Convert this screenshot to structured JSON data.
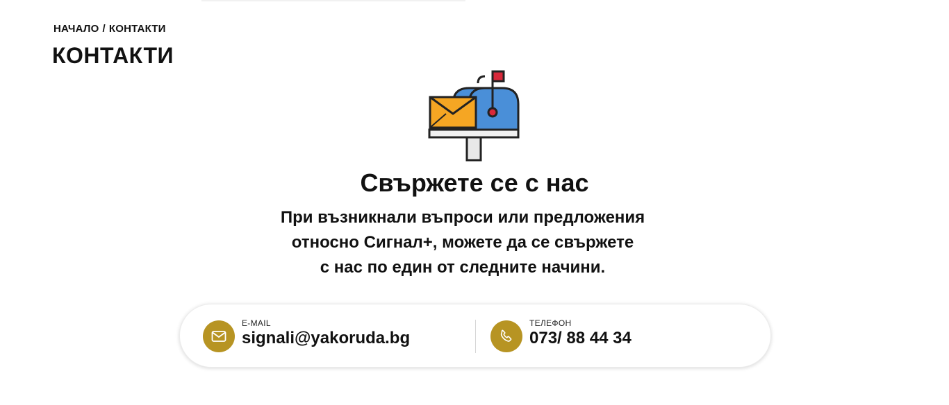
{
  "breadcrumb": {
    "home": "НАЧАЛО",
    "separator": "/",
    "current": "КОНТАКТИ"
  },
  "page_title": "КОНТАКТИ",
  "hero": {
    "icon": "mailbox-icon",
    "heading": "Свържете се с нас",
    "intro_lines": [
      "При възникнали въпроси или предложения",
      "относно Сигнал+, можете да се свържете",
      "с нас по един от следните начини."
    ]
  },
  "contacts": {
    "email": {
      "label": "E-MAIL",
      "value": "signali@yakoruda.bg",
      "icon": "envelope-icon"
    },
    "phone": {
      "label": "ТЕЛЕФОН",
      "value": "073/ 88 44 34",
      "icon": "phone-icon"
    }
  },
  "colors": {
    "accent": "#b79423",
    "mailbox_blue": "#4a8fd8",
    "envelope_orange": "#f5a623",
    "flag_red": "#d8283a"
  }
}
